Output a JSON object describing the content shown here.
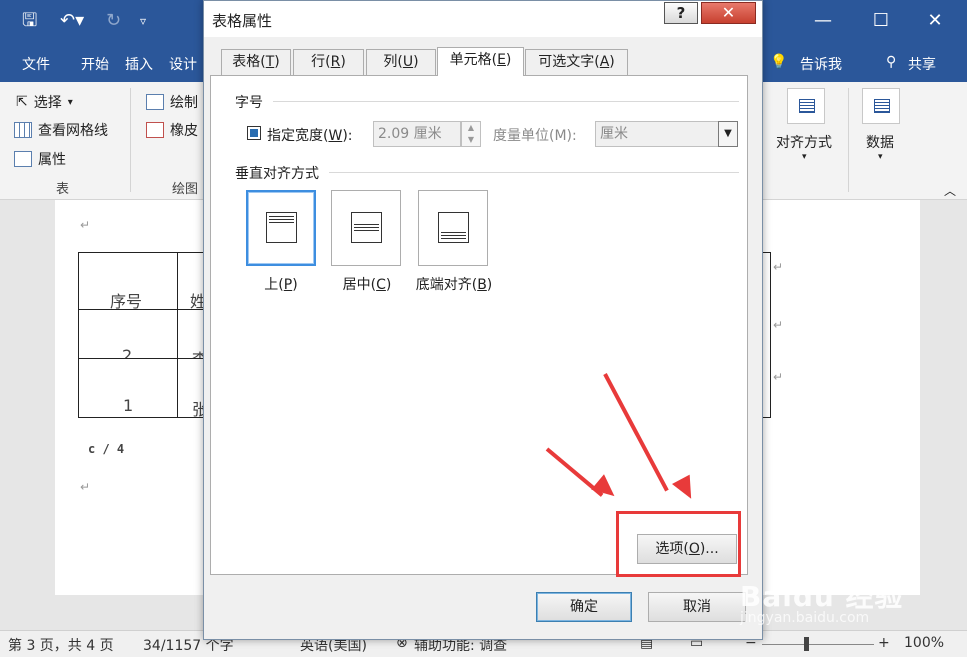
{
  "word": {
    "ribbon_tabs": [
      "文件",
      "开始",
      "插入",
      "设计"
    ],
    "tell_me": "告诉我",
    "share": "共享",
    "ribbon_left": {
      "select": "选择",
      "view_gridlines": "查看网格线",
      "properties": "属性",
      "group_table": "表",
      "draw": "绘制",
      "eraser": "橡皮",
      "group_draw": "绘图"
    },
    "ribbon_right": {
      "alignment": "对齐方式",
      "data": "数据"
    },
    "document": {
      "header_cell": "序号",
      "header_cell2": "姓",
      "row1_num": "2",
      "row1_name": "李",
      "row2_num": "1",
      "row2_name": "张",
      "page_note": "c / 4"
    },
    "status": {
      "page": "第 3 页，共 4 页",
      "words": "34/1157 个字",
      "language": "英语(美国)",
      "accessibility": "辅助功能: 调查",
      "zoom": "100%"
    }
  },
  "dialog": {
    "title": "表格属性",
    "help_label": "?",
    "close_label": "✕",
    "tabs": [
      {
        "label": "表格(",
        "key": "T",
        "end": ")"
      },
      {
        "label": "行(",
        "key": "R",
        "end": ")"
      },
      {
        "label": "列(",
        "key": "U",
        "end": ")"
      },
      {
        "label": "单元格(",
        "key": "E",
        "end": ")"
      },
      {
        "label": "可选文字(",
        "key": "A",
        "end": ")"
      }
    ],
    "active_tab": "单元格(E)",
    "size_section": "字号",
    "preferred_width_label": "指定宽度(",
    "preferred_width_key": "W",
    "preferred_width_end": "):",
    "width_value": "2.09 厘米",
    "measure_in_label": "度量单位(M):",
    "measure_in_value": "厘米",
    "valign_section": "垂直对齐方式",
    "align_options": [
      {
        "label": "上(",
        "key": "P",
        "end": ")",
        "selected": true
      },
      {
        "label": "居中(",
        "key": "C",
        "end": ")",
        "selected": false
      },
      {
        "label": "底端对齐(",
        "key": "B",
        "end": ")",
        "selected": false
      }
    ],
    "options_button": "选项(",
    "options_key": "O",
    "options_end": ")...",
    "ok_button": "确定",
    "cancel_button": "取消"
  },
  "annotation": {
    "highlight_color": "#e83a3a",
    "watermark": "Baidu 经验",
    "watermark_sub": "jingyan.baidu.com"
  },
  "colors": {
    "word_blue": "#2b579a",
    "dialog_bg": "#f0f0f0",
    "selected_border": "#3d8ee0"
  }
}
